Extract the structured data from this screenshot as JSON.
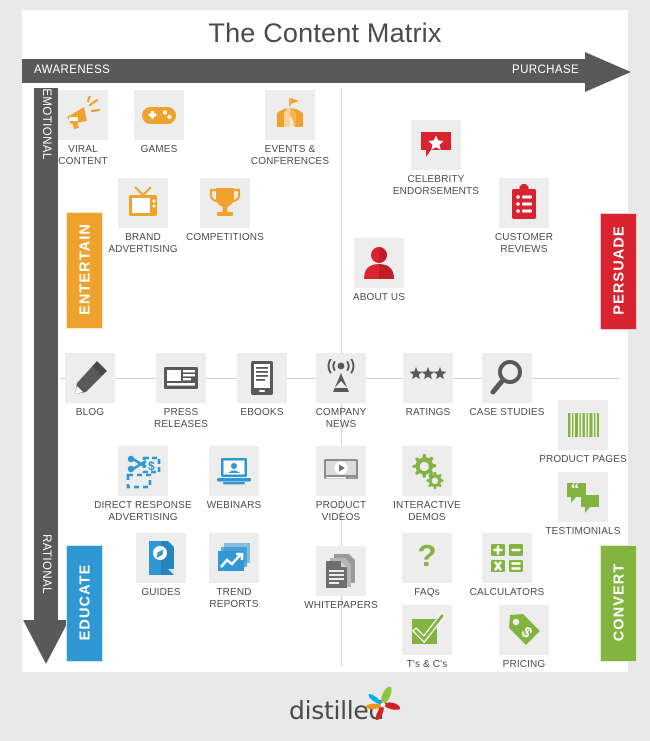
{
  "title": "The Content Matrix",
  "axes": {
    "horizontal": {
      "start": "AWARENESS",
      "end": "PURCHASE",
      "color": "#595959"
    },
    "vertical": {
      "start": "EMOTIONAL",
      "end": "RATIONAL",
      "color": "#595959"
    }
  },
  "quadrants": [
    {
      "key": "entertain",
      "label": "ENTERTAIN",
      "color": "#F0A22E",
      "position": "top-left"
    },
    {
      "key": "persuade",
      "label": "PERSUADE",
      "color": "#D9232E",
      "position": "top-right"
    },
    {
      "key": "educate",
      "label": "EDUCATE",
      "color": "#2E97D4",
      "position": "bottom-left"
    },
    {
      "key": "convert",
      "label": "CONVERT",
      "color": "#84B440",
      "position": "bottom-right"
    }
  ],
  "items": [
    {
      "label": "VIRAL CONTENT",
      "icon": "megaphone-icon",
      "quadrant": "entertain",
      "color": "#F0A22E"
    },
    {
      "label": "GAMES",
      "icon": "gamepad-icon",
      "quadrant": "entertain",
      "color": "#F0A22E"
    },
    {
      "label": "EVENTS & CONFERENCES",
      "icon": "tent-icon",
      "quadrant": "entertain",
      "color": "#F0A22E"
    },
    {
      "label": "BRAND ADVERTISING",
      "icon": "television-icon",
      "quadrant": "entertain",
      "color": "#F0A22E"
    },
    {
      "label": "COMPETITIONS",
      "icon": "trophy-icon",
      "quadrant": "entertain",
      "color": "#F0A22E"
    },
    {
      "label": "CELEBRITY ENDORSEMENTS",
      "icon": "star-speech-icon",
      "quadrant": "persuade",
      "color": "#D9232E"
    },
    {
      "label": "CUSTOMER REVIEWS",
      "icon": "clipboard-icon",
      "quadrant": "persuade",
      "color": "#D9232E"
    },
    {
      "label": "ABOUT US",
      "icon": "person-icon",
      "quadrant": "persuade",
      "color": "#D9232E"
    },
    {
      "label": "BLOG",
      "icon": "pencil-icon",
      "quadrant": "educate",
      "color": "#595959"
    },
    {
      "label": "PRESS RELEASES",
      "icon": "newspaper-icon",
      "quadrant": "educate",
      "color": "#595959"
    },
    {
      "label": "EBOOKS",
      "icon": "ereader-icon",
      "quadrant": "educate",
      "color": "#595959"
    },
    {
      "label": "COMPANY NEWS",
      "icon": "broadcast-icon",
      "quadrant": "center",
      "color": "#595959"
    },
    {
      "label": "RATINGS",
      "icon": "three-stars-icon",
      "quadrant": "convert",
      "color": "#595959"
    },
    {
      "label": "CASE STUDIES",
      "icon": "magnifier-icon",
      "quadrant": "convert",
      "color": "#595959"
    },
    {
      "label": "DIRECT RESPONSE ADVERTISING",
      "icon": "coupon-icon",
      "quadrant": "educate",
      "color": "#2E97D4"
    },
    {
      "label": "WEBINARS",
      "icon": "laptop-icon",
      "quadrant": "educate",
      "color": "#2E97D4"
    },
    {
      "label": "PRODUCT VIDEOS",
      "icon": "video-player-icon",
      "quadrant": "center",
      "color": "#595959"
    },
    {
      "label": "INTERACTIVE DEMOS",
      "icon": "gears-icon",
      "quadrant": "convert",
      "color": "#84B440"
    },
    {
      "label": "PRODUCT PAGES",
      "icon": "barcode-icon",
      "quadrant": "convert",
      "color": "#84B440"
    },
    {
      "label": "TESTIMONIALS",
      "icon": "quote-bubbles-icon",
      "quadrant": "convert",
      "color": "#84B440"
    },
    {
      "label": "GUIDES",
      "icon": "map-document-icon",
      "quadrant": "educate",
      "color": "#2E97D4"
    },
    {
      "label": "TREND REPORTS",
      "icon": "trend-chart-icon",
      "quadrant": "educate",
      "color": "#2E97D4"
    },
    {
      "label": "WHITEPAPERS",
      "icon": "documents-icon",
      "quadrant": "center",
      "color": "#595959"
    },
    {
      "label": "FAQs",
      "icon": "question-mark-icon",
      "quadrant": "convert",
      "color": "#84B440"
    },
    {
      "label": "CALCULATORS",
      "icon": "calculator-icon",
      "quadrant": "convert",
      "color": "#84B440"
    },
    {
      "label": "T's & C's",
      "icon": "checkbox-icon",
      "quadrant": "convert",
      "color": "#84B440"
    },
    {
      "label": "PRICING",
      "icon": "price-tag-icon",
      "quadrant": "convert",
      "color": "#84B440"
    }
  ],
  "captions": {
    "viral_content": "VIRAL\nCONTENT",
    "events": "EVENTS &\nCONFERENCES",
    "brand_ad": "BRAND\nADVERTISING",
    "celebrity": "CELEBRITY\nENDORSEMENTS",
    "cust_reviews": "CUSTOMER\nREVIEWS",
    "press_releases": "PRESS\nRELEASES",
    "company_news": "COMPANY\nNEWS",
    "direct_response": "DIRECT RESPONSE\nADVERTISING",
    "product_videos": "PRODUCT\nVIDEOS",
    "interactive": "INTERACTIVE\nDEMOS",
    "trend_reports": "TREND\nREPORTS"
  },
  "footer": {
    "logo_text": "distilled"
  },
  "colors": {
    "background": "#e9e9e9",
    "card": "#ffffff",
    "tile": "#ededed",
    "axis": "#595959",
    "gridline": "#d3d3d3",
    "text": "#4d4d4d",
    "orange": "#F0A22E",
    "red": "#D9232E",
    "blue": "#2E97D4",
    "green": "#84B440",
    "gray": "#595959"
  }
}
